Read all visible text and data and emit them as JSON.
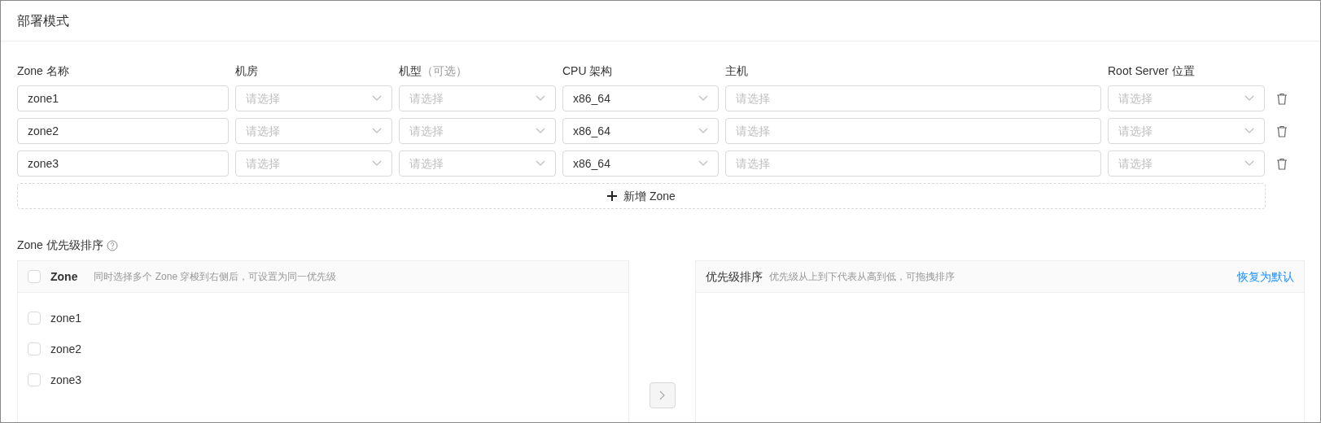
{
  "title": "部署模式",
  "zone_table": {
    "columns": [
      {
        "label": "Zone 名称"
      },
      {
        "label": "机房"
      },
      {
        "label": "机型",
        "hint": "（可选）"
      },
      {
        "label": "CPU 架构"
      },
      {
        "label": "主机"
      },
      {
        "label": "Root Server 位置"
      }
    ],
    "rows": [
      {
        "name": "zone1",
        "room": {
          "placeholder": "请选择"
        },
        "model": {
          "placeholder": "请选择"
        },
        "cpu": {
          "value": "x86_64"
        },
        "host": {
          "placeholder": "请选择"
        },
        "root_server": {
          "placeholder": "请选择"
        }
      },
      {
        "name": "zone2",
        "room": {
          "placeholder": "请选择"
        },
        "model": {
          "placeholder": "请选择"
        },
        "cpu": {
          "value": "x86_64"
        },
        "host": {
          "placeholder": "请选择"
        },
        "root_server": {
          "placeholder": "请选择"
        }
      },
      {
        "name": "zone3",
        "room": {
          "placeholder": "请选择"
        },
        "model": {
          "placeholder": "请选择"
        },
        "cpu": {
          "value": "x86_64"
        },
        "host": {
          "placeholder": "请选择"
        },
        "root_server": {
          "placeholder": "请选择"
        }
      }
    ],
    "add_button": "新增 Zone"
  },
  "priority": {
    "label": "Zone 优先级排序",
    "left": {
      "title": "Zone",
      "hint": "同时选择多个 Zone 穿梭到右侧后，可设置为同一优先级",
      "checked": false,
      "items": [
        {
          "label": "zone1",
          "checked": false
        },
        {
          "label": "zone2",
          "checked": false
        },
        {
          "label": "zone3",
          "checked": false
        }
      ]
    },
    "transfer_disabled": true,
    "right": {
      "title": "优先级排序",
      "hint": "优先级从上到下代表从高到低，可拖拽排序",
      "reset_link": "恢复为默认"
    }
  }
}
